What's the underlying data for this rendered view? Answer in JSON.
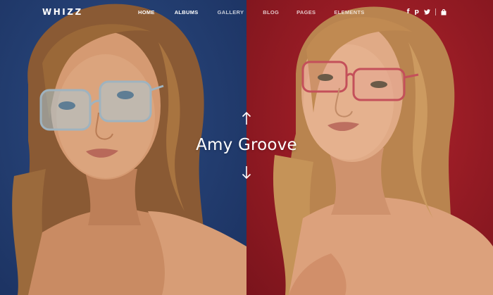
{
  "brand": {
    "logo_text": "WHIZZ"
  },
  "nav": {
    "items": [
      {
        "label": "HOME",
        "active": true
      },
      {
        "label": "ALBUMS",
        "active": true
      },
      {
        "label": "GALLERY",
        "active": false
      },
      {
        "label": "BLOG",
        "active": false
      },
      {
        "label": "PAGES",
        "active": false
      },
      {
        "label": "ELEMENTS",
        "active": false
      }
    ]
  },
  "social": {
    "icons": [
      "facebook-icon",
      "pinterest-icon",
      "twitter-icon",
      "shopping-bag-icon"
    ],
    "facebook_glyph": "f",
    "pinterest_glyph": "p"
  },
  "hero": {
    "title": "Amy Groove",
    "left_bg": "#243f72",
    "right_bg": "#951b24"
  }
}
